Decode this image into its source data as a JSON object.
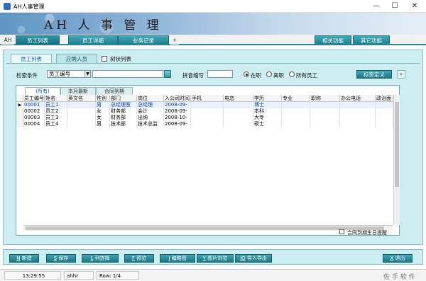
{
  "window": {
    "title": "AH人事管理",
    "minimize": "—",
    "maximize": "☐",
    "close": "✕"
  },
  "banner": {
    "brand": "AH 人 事 管 理"
  },
  "top_tabs": {
    "ah": "AH",
    "tab1": "员工列表",
    "tab2": "员工详细",
    "tab3": "业务记录",
    "plus": "+",
    "right1": "相关功能",
    "right2": "其它功能"
  },
  "panel_tabs": {
    "tab1": "员工列表",
    "tab2": "应聘人员",
    "tree": "树状列表"
  },
  "search": {
    "label": "检索条件",
    "field_value": "员工编号",
    "text_value": "",
    "pinyin_label": "拼音缩写",
    "pinyin_value": "",
    "radio_onjob": "在职",
    "radio_left": "离职",
    "radio_all": "所有员工",
    "tag_button": "标签定义",
    "collapse": "»"
  },
  "grid": {
    "subtabs": [
      "(所有)",
      "本月最新",
      "合同到期"
    ],
    "columns": [
      "员工编号",
      "姓名",
      "英文名",
      "性别",
      "部门",
      "岗位",
      "入公司时间",
      "手机",
      "电恋",
      "学历",
      "专业",
      "职称",
      "办公电话",
      "政治面"
    ],
    "rows": [
      [
        "00001",
        "员工1",
        "",
        "男",
        "总经理室",
        "总经理",
        "2008-09-",
        "",
        "",
        "博士",
        "",
        "",
        "",
        ""
      ],
      [
        "00002",
        "员工2",
        "",
        "女",
        "财务部",
        "会计",
        "2008-09-",
        "",
        "",
        "本科",
        "",
        "",
        "",
        ""
      ],
      [
        "00003",
        "员工3",
        "",
        "女",
        "财务部",
        "出纳",
        "2008-10-",
        "",
        "",
        "大专",
        "",
        "",
        "",
        ""
      ],
      [
        "00004",
        "员工4",
        "",
        "男",
        "技术部",
        "技术总监",
        "2008-09-",
        "",
        "",
        "硕士",
        "",
        "",
        "",
        ""
      ]
    ],
    "birthday_reminder": "合同到期生日提醒"
  },
  "buttons": [
    {
      "key": "N",
      "label": "新建"
    },
    {
      "key": "S",
      "label": "保存"
    },
    {
      "key": "L",
      "label": "列选择"
    },
    {
      "key": "F",
      "label": "预览"
    },
    {
      "key": "I",
      "label": "编略图"
    },
    {
      "key": "Y",
      "label": "图片浏览"
    },
    {
      "key": "IO",
      "label": "导入导出"
    }
  ],
  "exit_button": {
    "key": "X",
    "label": "退出"
  },
  "status": {
    "time": "13:29:55",
    "user": "ahhr",
    "row": "Row: 1/4",
    "watermark": "佐 手 软 件"
  },
  "colors": {
    "teal": "#1f7f8e",
    "panel": "#cdeef0",
    "selected_text": "#0a3fb8"
  }
}
